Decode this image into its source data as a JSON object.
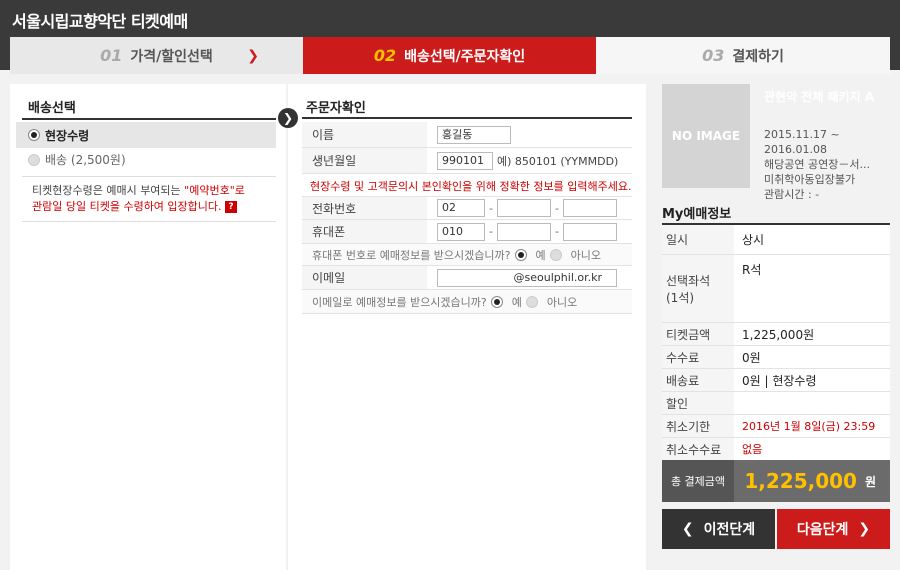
{
  "header": {
    "title": "서울시립교향악단 티켓예매"
  },
  "steps": [
    {
      "num": "01",
      "label": "가격/할인선택"
    },
    {
      "num": "02",
      "label": "배송선택/주문자확인"
    },
    {
      "num": "03",
      "label": "결제하기"
    }
  ],
  "delivery": {
    "title": "배송선택",
    "options": [
      {
        "label": "현장수령",
        "selected": true
      },
      {
        "label": "배송 (2,500원)",
        "selected": false
      }
    ],
    "notice_prefix": "티켓현장수령은 예매시 부여되는 ",
    "notice_red": "\"예약번호\"로",
    "notice_line2": "관람일 당일 티켓을 수령하여 입장합니다.",
    "help_label": "?"
  },
  "orderer": {
    "title": "주문자확인",
    "name_label": "이름",
    "name_value": "홍길동",
    "birth_label": "생년월일",
    "birth_value": "990101",
    "birth_hint": "예) 850101 (YYMMDD)",
    "warning": "현장수령 및 고객문의시 본인확인을 위해 정확한 정보를 입력해주세요.",
    "phone_label": "전화번호",
    "phone": [
      "02",
      "",
      ""
    ],
    "mobile_label": "휴대폰",
    "mobile": [
      "010",
      "",
      ""
    ],
    "sms_question": "휴대폰 번호로 예매정보를 받으시겠습니까?",
    "email_label": "이메일",
    "email_value": "@seoulphil.or.kr",
    "email_question": "이메일로 예매정보를 받으시겠습니까?",
    "yes": "예",
    "no": "아니오"
  },
  "product": {
    "image_text": "NO IMAGE",
    "name": "관현악 전체 패키지 A",
    "period": "2015.11.17 ~ 2016.01.08",
    "venue": "해당공연 공연장－서...",
    "age": "미취학아동입장불가",
    "runtime": "관람시간 : -"
  },
  "my_booking": {
    "title": "My예매정보",
    "rows": [
      {
        "label": "일시",
        "value": "상시"
      },
      {
        "label": "선택좌석\n(1석)",
        "value": "R석"
      },
      {
        "label": "티켓금액",
        "value": "1,225,000원"
      },
      {
        "label": "수수료",
        "value": "0원"
      },
      {
        "label": "배송료",
        "value": "0원 | 현장수령"
      },
      {
        "label": "할인",
        "value": ""
      },
      {
        "label": "취소기한",
        "value": "2016년 1월 8일(금) 23:59"
      },
      {
        "label": "취소수수료",
        "value": "없음"
      }
    ],
    "total_label": "총 결제금액",
    "total_value": "1,225,000",
    "total_unit": "원"
  },
  "buttons": {
    "prev": "이전단계",
    "next": "다음단계"
  },
  "colors": {
    "accent": "#cc1b1b",
    "highlight": "#ffc000"
  }
}
